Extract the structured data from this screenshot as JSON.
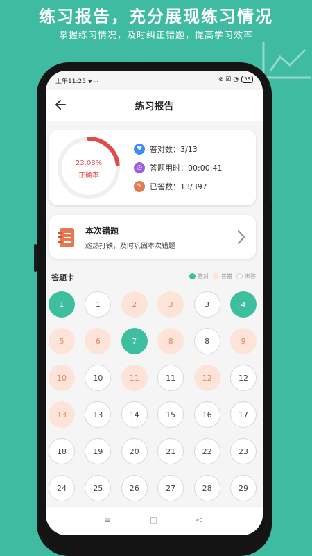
{
  "promo": {
    "title": "练习报告，充分展现练习情况",
    "subtitle": "掌握练习情况，及时纠正错题，提高学习效率"
  },
  "status_bar": {
    "time": "上午11:25",
    "extra_icons": "✱ ···",
    "right_icons": "⊘ ☒ ◔",
    "battery": "53"
  },
  "navbar": {
    "back_icon": "back-arrow-icon",
    "title": "练习报告"
  },
  "summary": {
    "accuracy_fraction": 0.2308,
    "accuracy_text": "23.08%",
    "accuracy_label": "正确率",
    "stats": [
      {
        "icon": "heart-icon",
        "color": "#3b8ff2",
        "glyph": "♥",
        "text": "答对数：3/13"
      },
      {
        "icon": "clock-icon",
        "color": "#9b5de5",
        "glyph": "◷",
        "text": "答题用时：00:00:41"
      },
      {
        "icon": "tag-icon",
        "color": "#e07b53",
        "glyph": "✎",
        "text": "已答数：13/397"
      }
    ]
  },
  "wrong_questions": {
    "icon": "notebook-icon",
    "title": "本次错题",
    "description": "趁热打铁，及时巩固本次错题",
    "arrow": "chevron-right-icon"
  },
  "answer_card": {
    "title": "答题卡",
    "legend": [
      {
        "key": "correct",
        "label": "答对",
        "color": "#3dbf9f"
      },
      {
        "key": "wrong",
        "label": "答错",
        "color": "#fde3d8"
      },
      {
        "key": "unanswered",
        "label": "未答",
        "color": "#ffffff"
      }
    ],
    "questions": [
      {
        "n": "1",
        "s": "correct"
      },
      {
        "n": "1",
        "s": "unanswered"
      },
      {
        "n": "2",
        "s": "wrong"
      },
      {
        "n": "3",
        "s": "wrong"
      },
      {
        "n": "3",
        "s": "unanswered"
      },
      {
        "n": "4",
        "s": "correct"
      },
      {
        "n": "5",
        "s": "wrong"
      },
      {
        "n": "6",
        "s": "wrong"
      },
      {
        "n": "7",
        "s": "correct"
      },
      {
        "n": "8",
        "s": "wrong"
      },
      {
        "n": "8",
        "s": "unanswered"
      },
      {
        "n": "9",
        "s": "wrong"
      },
      {
        "n": "10",
        "s": "wrong"
      },
      {
        "n": "10",
        "s": "unanswered"
      },
      {
        "n": "11",
        "s": "wrong"
      },
      {
        "n": "11",
        "s": "unanswered"
      },
      {
        "n": "12",
        "s": "wrong"
      },
      {
        "n": "12",
        "s": "unanswered"
      },
      {
        "n": "13",
        "s": "wrong"
      },
      {
        "n": "13",
        "s": "unanswered"
      },
      {
        "n": "14",
        "s": "unanswered"
      },
      {
        "n": "15",
        "s": "unanswered"
      },
      {
        "n": "16",
        "s": "unanswered"
      },
      {
        "n": "17",
        "s": "unanswered"
      },
      {
        "n": "18",
        "s": "unanswered"
      },
      {
        "n": "19",
        "s": "unanswered"
      },
      {
        "n": "20",
        "s": "unanswered"
      },
      {
        "n": "21",
        "s": "unanswered"
      },
      {
        "n": "22",
        "s": "unanswered"
      },
      {
        "n": "23",
        "s": "unanswered"
      },
      {
        "n": "24",
        "s": "unanswered"
      },
      {
        "n": "25",
        "s": "unanswered"
      },
      {
        "n": "26",
        "s": "unanswered"
      },
      {
        "n": "27",
        "s": "unanswered"
      },
      {
        "n": "28",
        "s": "unanswered"
      },
      {
        "n": "29",
        "s": "unanswered"
      }
    ]
  },
  "system_nav": {
    "menu": "≡",
    "home": "□",
    "back": "<"
  }
}
